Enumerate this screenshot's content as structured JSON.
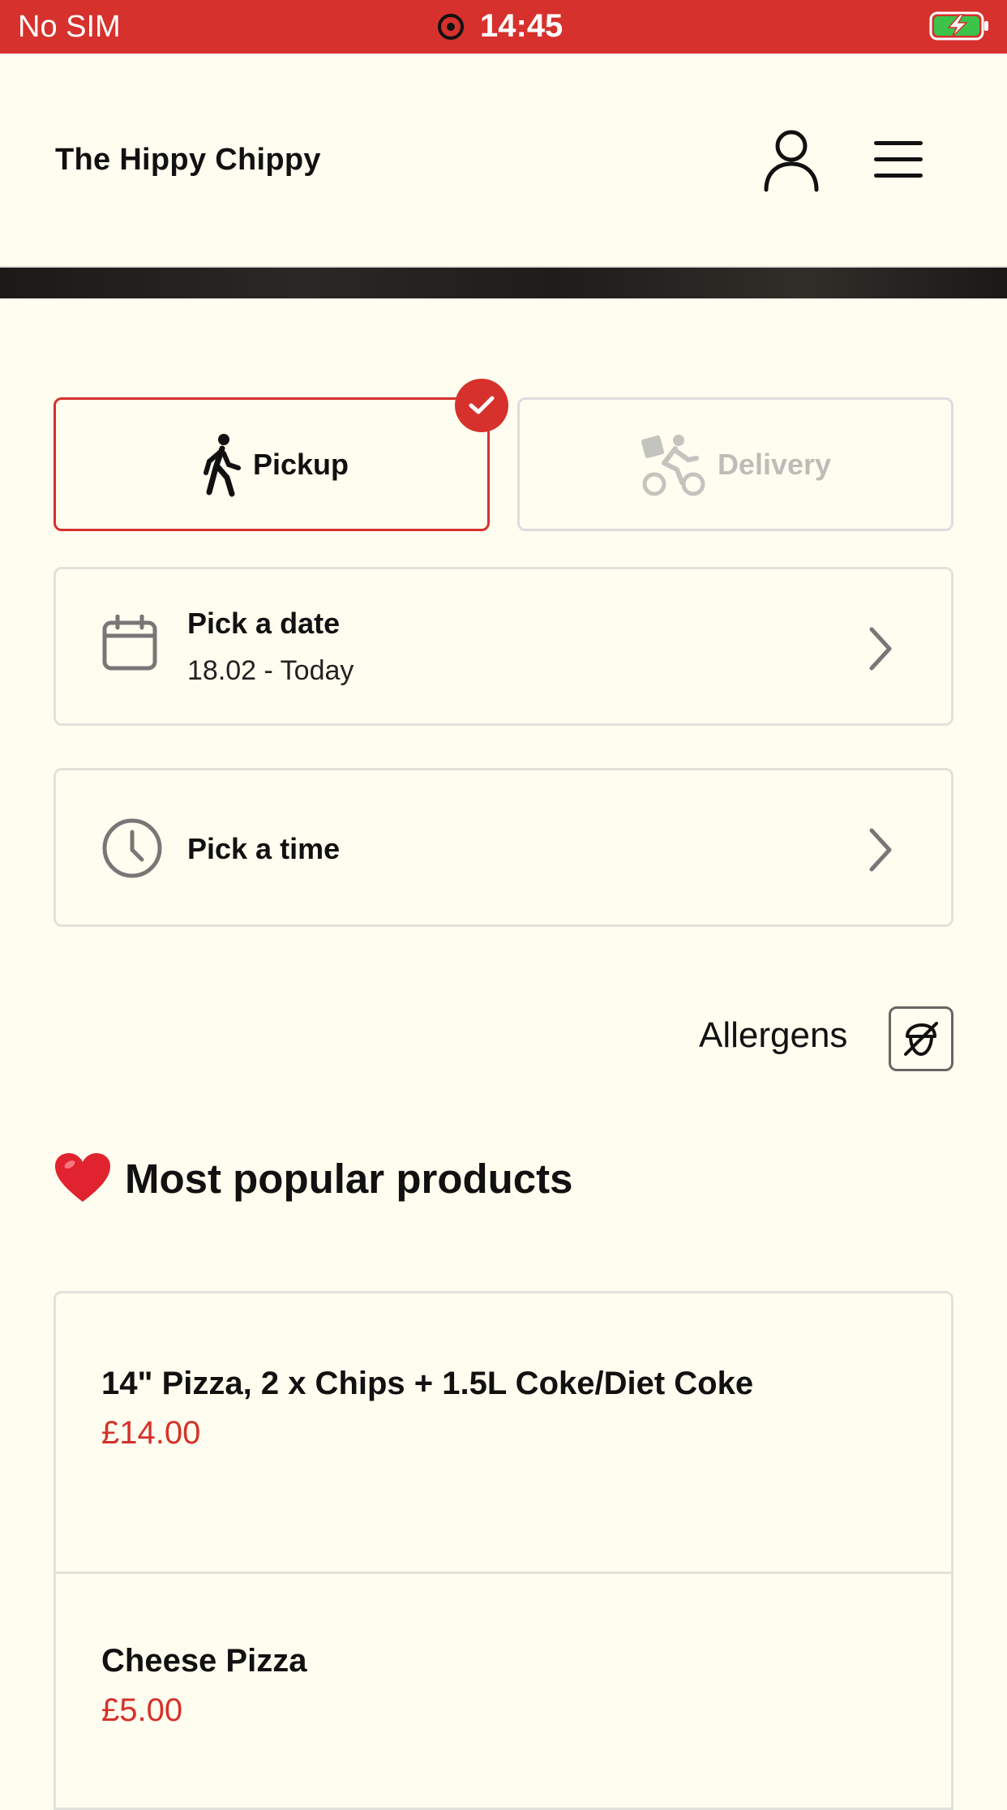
{
  "status_bar": {
    "carrier": "No SIM",
    "time": "14:45"
  },
  "header": {
    "brand": "The Hippy Chippy"
  },
  "modes": [
    {
      "label": "Pickup",
      "selected": true
    },
    {
      "label": "Delivery",
      "selected": false
    }
  ],
  "date_picker": {
    "title": "Pick a date",
    "value": "18.02 - Today"
  },
  "time_picker": {
    "title": "Pick a time"
  },
  "allergens": {
    "label": "Allergens"
  },
  "popular": {
    "title": "Most popular products",
    "products": [
      {
        "name": "14\" Pizza, 2 x Chips + 1.5L Coke/Diet Coke",
        "price": "£14.00"
      },
      {
        "name": "Cheese Pizza",
        "price": "£5.00"
      }
    ]
  },
  "colors": {
    "accent": "#D6312C",
    "background": "#FFFDEF",
    "border": "#e2e2dc",
    "disabled_text": "#bdbdb8"
  }
}
